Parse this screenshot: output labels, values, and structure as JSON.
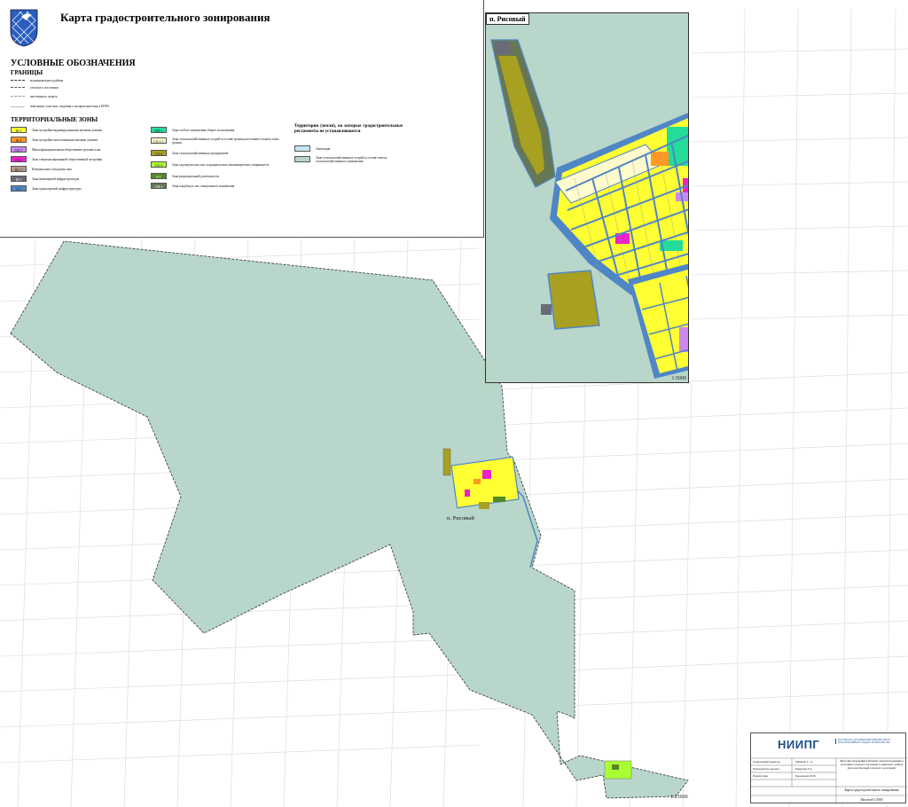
{
  "title": "Карта градостроительного зонирования",
  "legend": {
    "heading": "УСЛОВНЫЕ ОБОЗНАЧЕНИЯ",
    "boundaries_heading": "ГРАНИЦЫ",
    "boundaries": [
      {
        "label": "муниципального района",
        "style": "dashed-dark"
      },
      {
        "label": "сельского поселения",
        "style": "dash-dot"
      },
      {
        "label": "населенного пункта",
        "style": "dashed-light"
      },
      {
        "label": "земельных участков, сведения о которых внесены в ЕГРН",
        "style": "thin"
      }
    ],
    "zones_heading": "ТЕРРИТОРИАЛЬНЫЕ ЗОНЫ",
    "zones_col1": [
      {
        "code": "Ж-1",
        "label": "Зона застройки индивидуальными жилыми домами",
        "color": "#ffff33"
      },
      {
        "code": "Ж-2",
        "label": "Зона застройки малоэтажными жилыми домами",
        "color": "#ff9922"
      },
      {
        "code": "ОД-1",
        "label": "Многофункциональная общественно-деловая зона",
        "color": "#cc88ee"
      },
      {
        "code": "ОД-2",
        "label": "Зона специализированной общественной застройки",
        "color": "#ee22cc"
      },
      {
        "code": "КС-1",
        "label": "Коммунально-складская зона",
        "color": "#b09a8a"
      },
      {
        "code": "И-1",
        "label": "Зона инженерной инфраструктуры",
        "color": "#6a6a7a"
      },
      {
        "code": "Т-1",
        "label": "Зона транспортной инфраструктуры",
        "color": "#4f86c6"
      }
    ],
    "zones_col2": [
      {
        "code": "ОП-1",
        "label": "Зона особого назначения общего пользования",
        "color": "#22dd99"
      },
      {
        "code": "СХ-1.1",
        "label": "Зона сельскохозяйственных угодий в составе границ населенного пункта и вне границ",
        "color": "#fffbcc"
      },
      {
        "code": "СХ-2",
        "label": "Зона сельскохозяйственных предприятий",
        "color": "#a8a020"
      },
      {
        "code": "СХ-3",
        "label": "Зона садоводческих или огороднических некоммерческих товариществ",
        "color": "#aaff33"
      },
      {
        "code": "Р-1",
        "label": "Зона рекреационной деятельности",
        "color": "#558822"
      },
      {
        "code": "СН-1",
        "label": "Зона кладбищ и зон специального назначения",
        "color": "#667755"
      }
    ],
    "lands_heading": "Территории (земли), на которые градостроительные регламенты не устанавливаются",
    "lands": [
      {
        "label": "Акватории",
        "color": "#c8e6f5"
      },
      {
        "label": "Зона сельскохозяйственных угодий в составе земель сельскохозяйственного назначения",
        "color": "#b8d6c9"
      }
    ]
  },
  "inset": {
    "title": "п. Рисовый",
    "scale": "1:5000"
  },
  "map": {
    "place_label": "п. Рисовый",
    "scale": "1:25000"
  },
  "stamp": {
    "org_logo": "НИИПГ",
    "org_name": "НАУЧНО-ИССЛЕДОВАТЕЛЬСКИЙ ИНСТИТУТ ПЕРСПЕКТИВНОГО ГРАДОСТРОИТЕЛЬСТВА",
    "rows": [
      {
        "role": "Генеральный директор",
        "name": "Митягин С. Д."
      },
      {
        "role": "Руководитель проекта",
        "name": "Камалова Т.А."
      },
      {
        "role": "Разработчик",
        "name": "Бородачева М.М."
      }
    ],
    "project": "Внесение изменений в Правила землепользования и застройки сельского поселения Славянского района (поселок Рисовый сельского поселения)",
    "sheet": "Карта градостроительного зонирования",
    "scale": "Масштаб 1:5000"
  },
  "colors": {
    "agri": "#b8d6c9",
    "road": "#4f86c6",
    "residential": "#ffff33"
  }
}
